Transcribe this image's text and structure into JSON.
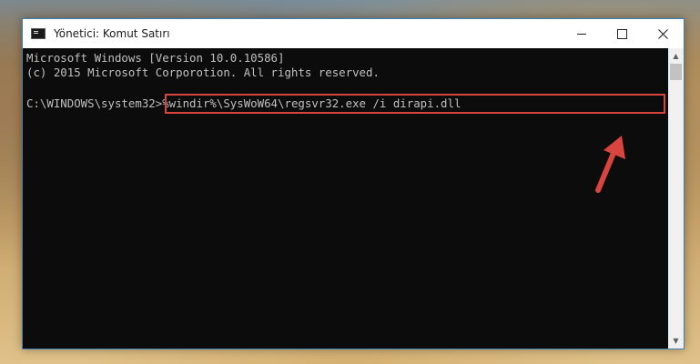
{
  "window": {
    "title": "Yönetici: Komut Satırı"
  },
  "console": {
    "lines": [
      "Microsoft Windows [Version 10.0.10586]",
      "(c) 2015 Microsoft Corporotion. All rights reserved."
    ],
    "prompt": "C:\\WINDOWS\\system32>",
    "command": "%windir%\\SysWoW64\\regsvr32.exe /i dirapi.dll"
  },
  "colors": {
    "console_bg": "#0c0c0c",
    "console_text": "#c0c0c0",
    "highlight": "#d8453f",
    "arrow": "#d8453f"
  },
  "icons": {
    "app": "cmd-icon",
    "minimize": "minimize-icon",
    "maximize": "maximize-icon",
    "close": "close-icon",
    "scroll_up": "scroll-up-icon",
    "scroll_down": "scroll-down-icon",
    "annotation": "red-arrow-icon"
  }
}
